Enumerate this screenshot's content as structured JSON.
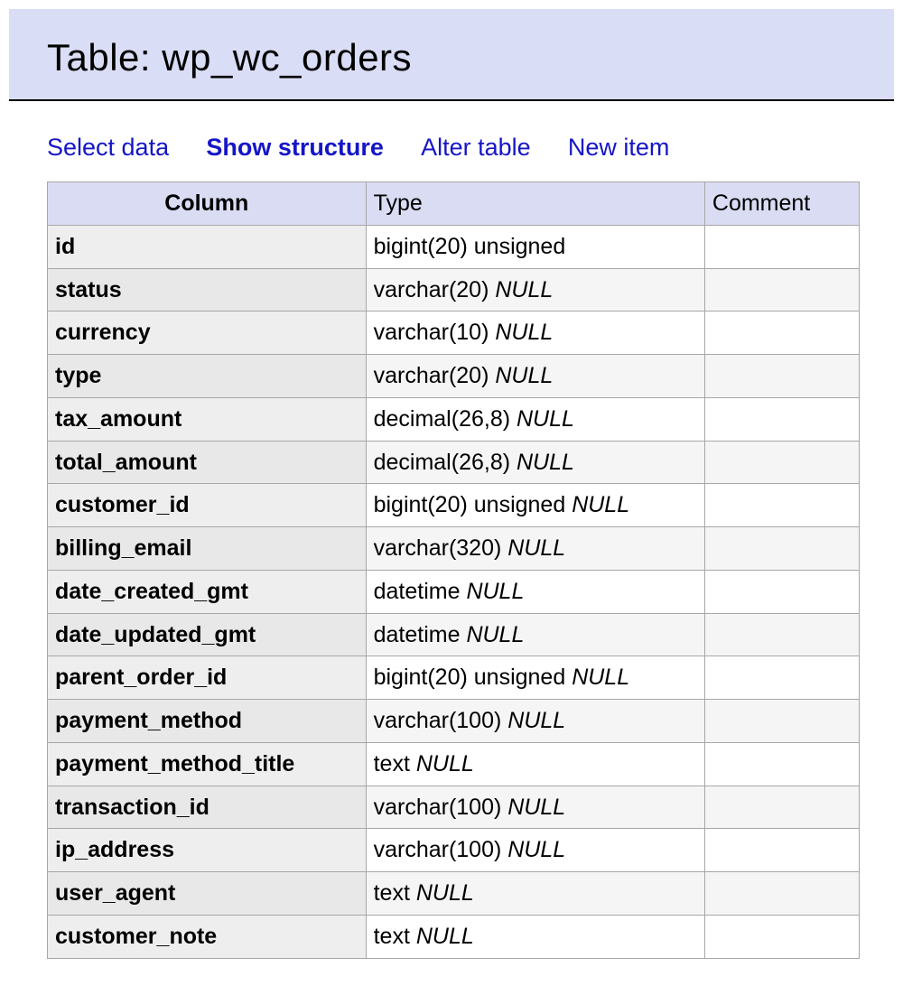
{
  "header": {
    "title_prefix": "Table:",
    "table_name": "wp_wc_orders"
  },
  "nav": {
    "select_data": "Select data",
    "show_structure": "Show structure",
    "alter_table": "Alter table",
    "new_item": "New item",
    "active": "show_structure"
  },
  "table": {
    "headers": {
      "column": "Column",
      "type": "Type",
      "comment": "Comment"
    },
    "null_label": "NULL",
    "rows": [
      {
        "column": "id",
        "type": "bigint(20) unsigned",
        "nullable": false,
        "comment": ""
      },
      {
        "column": "status",
        "type": "varchar(20)",
        "nullable": true,
        "comment": ""
      },
      {
        "column": "currency",
        "type": "varchar(10)",
        "nullable": true,
        "comment": ""
      },
      {
        "column": "type",
        "type": "varchar(20)",
        "nullable": true,
        "comment": ""
      },
      {
        "column": "tax_amount",
        "type": "decimal(26,8)",
        "nullable": true,
        "comment": ""
      },
      {
        "column": "total_amount",
        "type": "decimal(26,8)",
        "nullable": true,
        "comment": ""
      },
      {
        "column": "customer_id",
        "type": "bigint(20) unsigned",
        "nullable": true,
        "comment": ""
      },
      {
        "column": "billing_email",
        "type": "varchar(320)",
        "nullable": true,
        "comment": ""
      },
      {
        "column": "date_created_gmt",
        "type": "datetime",
        "nullable": true,
        "comment": ""
      },
      {
        "column": "date_updated_gmt",
        "type": "datetime",
        "nullable": true,
        "comment": ""
      },
      {
        "column": "parent_order_id",
        "type": "bigint(20) unsigned",
        "nullable": true,
        "comment": ""
      },
      {
        "column": "payment_method",
        "type": "varchar(100)",
        "nullable": true,
        "comment": ""
      },
      {
        "column": "payment_method_title",
        "type": "text",
        "nullable": true,
        "comment": ""
      },
      {
        "column": "transaction_id",
        "type": "varchar(100)",
        "nullable": true,
        "comment": ""
      },
      {
        "column": "ip_address",
        "type": "varchar(100)",
        "nullable": true,
        "comment": ""
      },
      {
        "column": "user_agent",
        "type": "text",
        "nullable": true,
        "comment": ""
      },
      {
        "column": "customer_note",
        "type": "text",
        "nullable": true,
        "comment": ""
      }
    ]
  }
}
